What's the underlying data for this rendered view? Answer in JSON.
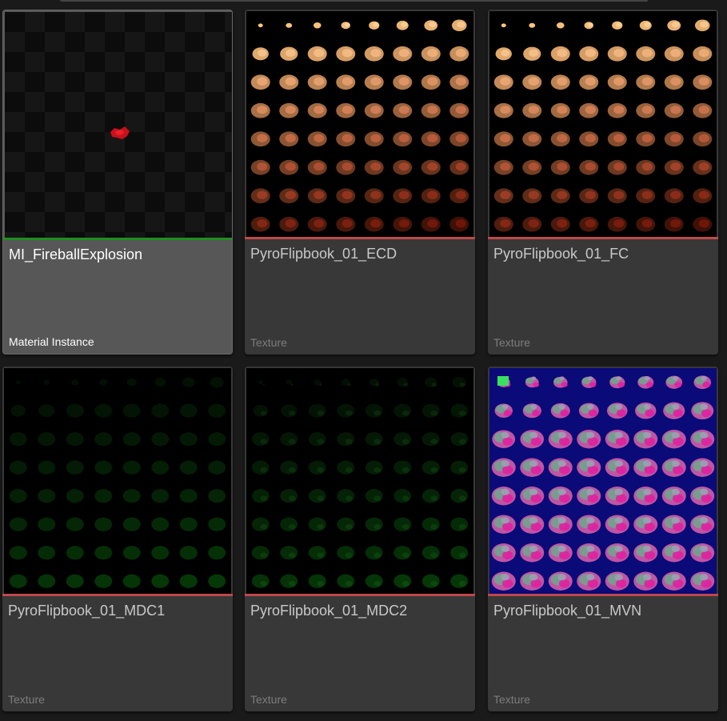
{
  "assets": [
    {
      "name": "MI_FireballExplosion",
      "type": "Material Instance",
      "type_color": "#1f8f1f",
      "selected": true,
      "thumbnail": "fireball-preview"
    },
    {
      "name": "PyroFlipbook_01_ECD",
      "type": "Texture",
      "type_color": "#c0484a",
      "selected": false,
      "thumbnail": "flipbook-ecd"
    },
    {
      "name": "PyroFlipbook_01_FC",
      "type": "Texture",
      "type_color": "#c0484a",
      "selected": false,
      "thumbnail": "flipbook-fc"
    },
    {
      "name": "PyroFlipbook_01_MDC1",
      "type": "Texture",
      "type_color": "#c0484a",
      "selected": false,
      "thumbnail": "flipbook-mdc1"
    },
    {
      "name": "PyroFlipbook_01_MDC2",
      "type": "Texture",
      "type_color": "#c0484a",
      "selected": false,
      "thumbnail": "flipbook-mdc2"
    },
    {
      "name": "PyroFlipbook_01_MVN",
      "type": "Texture",
      "type_color": "#c0484a",
      "selected": false,
      "thumbnail": "flipbook-mvn"
    }
  ]
}
